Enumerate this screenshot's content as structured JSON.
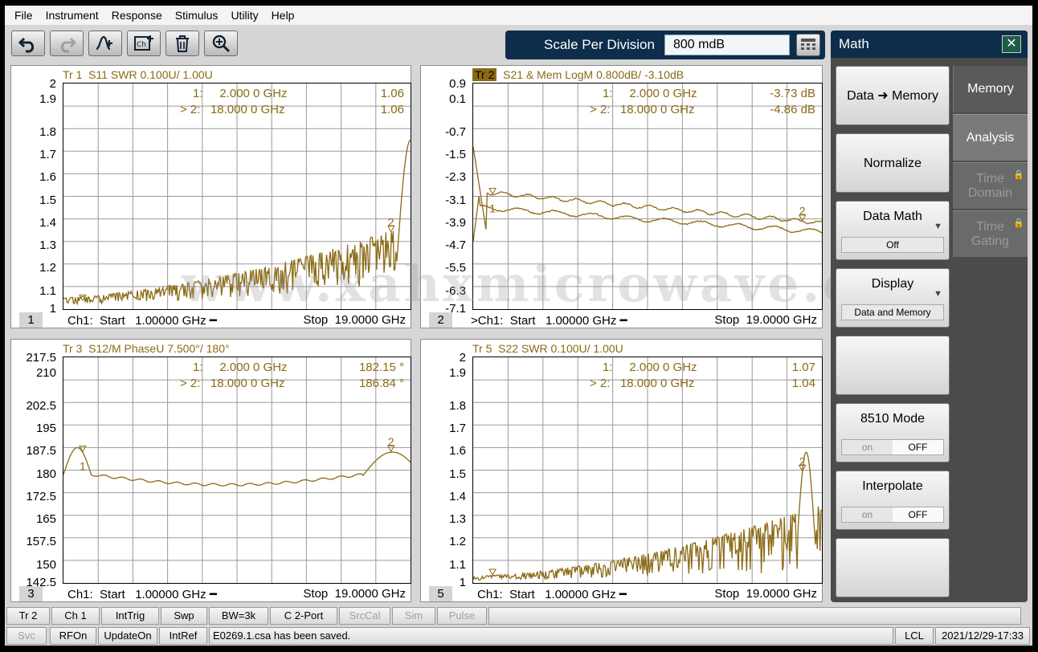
{
  "menu": [
    "File",
    "Instrument",
    "Response",
    "Stimulus",
    "Utility",
    "Help"
  ],
  "toolbar": {
    "icons": [
      "undo-icon",
      "redo-icon",
      "add-marker-icon",
      "channel-add-icon",
      "delete-icon",
      "zoom-icon"
    ]
  },
  "scale": {
    "label": "Scale Per Division",
    "value": "800 mdB"
  },
  "panel": {
    "title": "Math",
    "buttons": {
      "data_memory": "Data ➜ Memory",
      "normalize": "Normalize",
      "data_math": "Data Math",
      "data_math_value": "Off",
      "display": "Display",
      "display_value": "Data and Memory",
      "mode8510": "8510 Mode",
      "interpolate": "Interpolate",
      "on": "on",
      "off": "OFF"
    },
    "tabs": {
      "memory": "Memory",
      "analysis": "Analysis",
      "time_domain_1": "Time",
      "time_domain_2": "Domain",
      "time_gating_1": "Time",
      "time_gating_2": "Gating"
    }
  },
  "traces": {
    "t1": {
      "title_tr": "Tr  1",
      "title_rest": "S11 SWR 0.100U/  1.00U",
      "m1": "1:     2.000 0 GHz",
      "m1v": "1.06",
      "m2": "> 2:   18.000 0 GHz",
      "m2v": "1.06",
      "yticks": [
        "2",
        "1.9",
        "1.8",
        "1.7",
        "1.6",
        "1.5",
        "1.4",
        "1.3",
        "1.2",
        "1.1",
        "1"
      ],
      "num": "1",
      "start": "Ch1:  Start   1.00000 GHz ━",
      "stop": "Stop  19.0000 GHz"
    },
    "t2": {
      "title_tr": "Tr  2",
      "title_rest": "S21 & Mem LogM 0.800dB/  -3.10dB",
      "m1": "1:     2.000 0 GHz",
      "m1v": "-3.73 dB",
      "m2": "> 2:   18.000 0 GHz",
      "m2v": "-4.86 dB",
      "yticks": [
        "0.9",
        "0.1",
        "-0.7",
        "-1.5",
        "-2.3",
        "-3.1",
        "-3.9",
        "-4.7",
        "-5.5",
        "-6.3",
        "-7.1"
      ],
      "num": "2",
      "start": ">Ch1:  Start   1.00000 GHz ━",
      "stop": "Stop  19.0000 GHz"
    },
    "t3": {
      "title_tr": "Tr  3",
      "title_rest": "S12/M PhaseU 7.500°/  180°",
      "m1": "1:     2.000 0 GHz",
      "m1v": "182.15 °",
      "m2": "> 2:   18.000 0 GHz",
      "m2v": "186.84 °",
      "yticks": [
        "217.5",
        "210",
        "202.5",
        "195",
        "187.5",
        "180",
        "172.5",
        "165",
        "157.5",
        "150",
        "142.5"
      ],
      "num": "3",
      "start": "Ch1:  Start   1.00000 GHz ━",
      "stop": "Stop  19.0000 GHz"
    },
    "t5": {
      "title_tr": "Tr  5",
      "title_rest": "S22 SWR 0.100U/  1.00U",
      "m1": "1:     2.000 0 GHz",
      "m1v": "1.07",
      "m2": "> 2:   18.000 0 GHz",
      "m2v": "1.04",
      "yticks": [
        "2",
        "1.9",
        "1.8",
        "1.7",
        "1.6",
        "1.5",
        "1.4",
        "1.3",
        "1.2",
        "1.1",
        "1"
      ],
      "num": "5",
      "start": "Ch1:  Start   1.00000 GHz ━",
      "stop": "Stop  19.0000 GHz"
    }
  },
  "status1": [
    "Tr 2",
    "Ch 1",
    "IntTrig",
    "Swp",
    "BW=3k",
    "C  2-Port",
    "SrcCal",
    "Sim",
    "Pulse"
  ],
  "status2": [
    "Svc",
    "RFOn",
    "UpdateOn",
    "IntRef"
  ],
  "status_msg": "E0269.1.csa has been saved.",
  "lcl": "LCL",
  "datetime": "2021/12/29-17:33",
  "watermark": "www.xahxmicrowave.com",
  "colors": {
    "trace": "#8b6a14",
    "panel_header": "#0d2d4a"
  }
}
